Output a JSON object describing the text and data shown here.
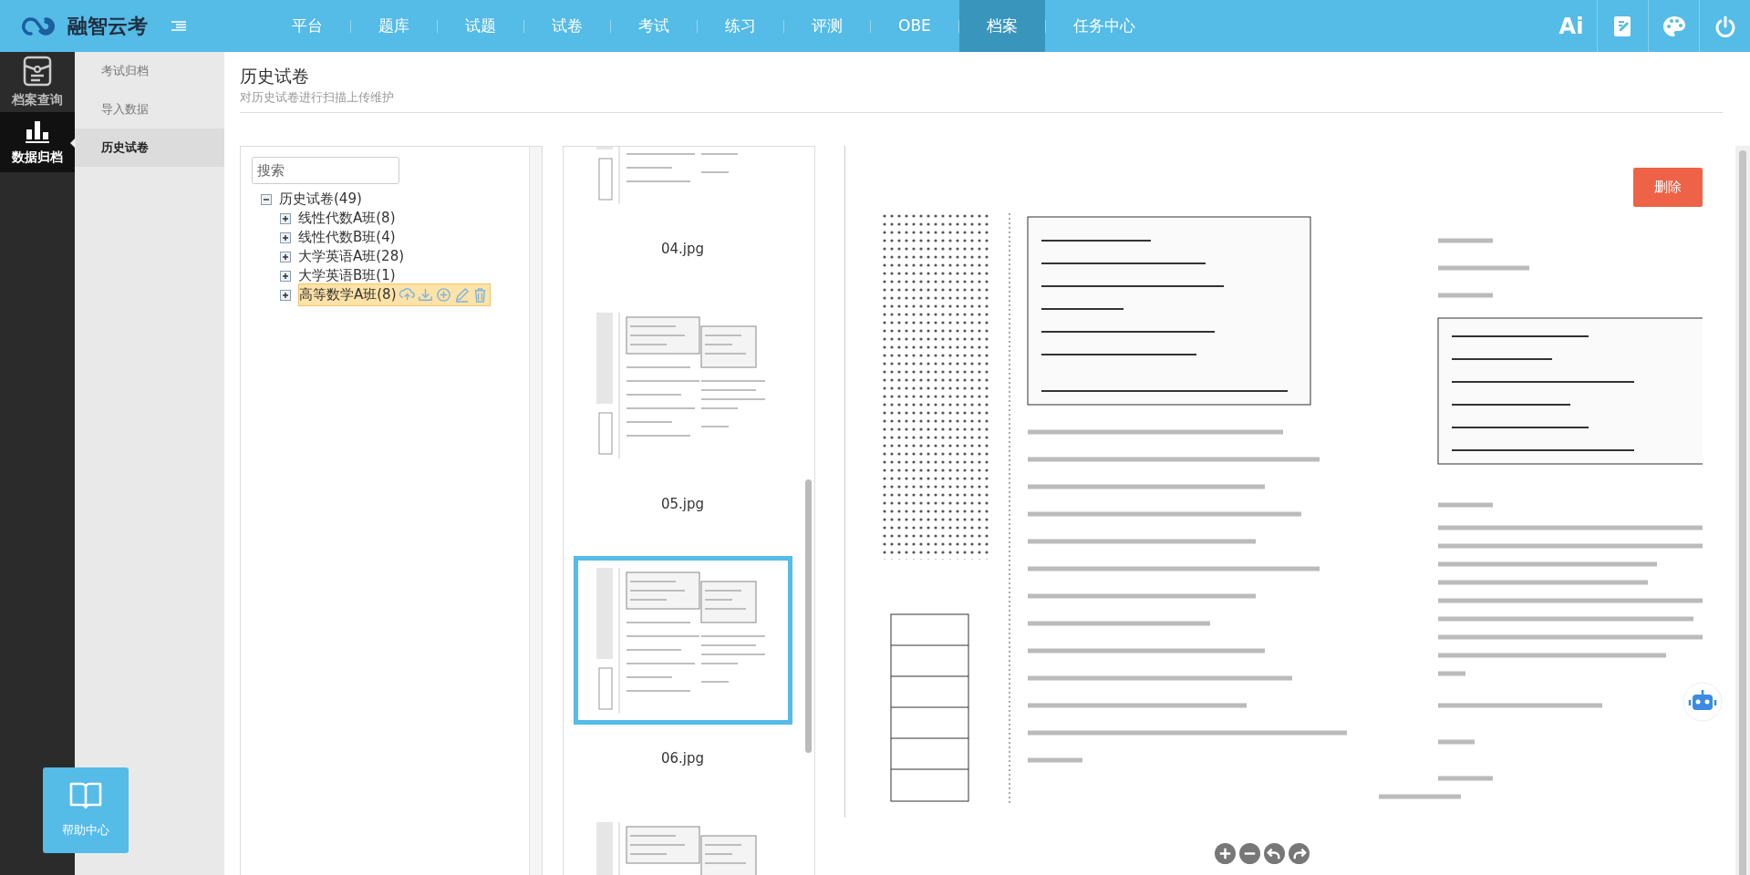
{
  "app": {
    "title": "融智云考"
  },
  "nav": [
    {
      "label": "平台",
      "selected": false
    },
    {
      "label": "题库",
      "selected": false
    },
    {
      "label": "试题",
      "selected": false
    },
    {
      "label": "试卷",
      "selected": false
    },
    {
      "label": "考试",
      "selected": false
    },
    {
      "label": "练习",
      "selected": false
    },
    {
      "label": "评测",
      "selected": false
    },
    {
      "label": "OBE",
      "selected": false
    },
    {
      "label": "档案",
      "selected": true
    },
    {
      "label": "任务中心",
      "selected": false
    }
  ],
  "header_actions": [
    {
      "kind": "ai",
      "label": "Ai"
    },
    {
      "kind": "edit"
    },
    {
      "kind": "palette"
    },
    {
      "kind": "power"
    }
  ],
  "sidebar": {
    "items": [
      {
        "kind": "archive",
        "label": "档案查询",
        "selected": false
      },
      {
        "kind": "chart",
        "label": "数据归档",
        "selected": true
      }
    ],
    "help": "帮助中心"
  },
  "submenu": [
    {
      "label": "考试归档",
      "selected": false
    },
    {
      "label": "导入数据",
      "selected": false
    },
    {
      "label": "历史试卷",
      "selected": true
    }
  ],
  "page": {
    "title": "历史试卷",
    "subtitle": "对历史试卷进行扫描上传维护"
  },
  "tree": {
    "search": {
      "placeholder": "搜索"
    },
    "root": {
      "label": "历史试卷(49)",
      "expanded": true,
      "children": [
        {
          "label": "线性代数A班(8)",
          "expanded": false,
          "selected": false
        },
        {
          "label": "线性代数B班(4)",
          "expanded": false,
          "selected": false
        },
        {
          "label": "大学英语A班(28)",
          "expanded": false,
          "selected": false
        },
        {
          "label": "大学英语B班(1)",
          "expanded": false,
          "selected": false
        },
        {
          "label": "高等数学A班(8)",
          "expanded": false,
          "selected": true
        }
      ]
    }
  },
  "thumbnails": [
    {
      "file": "04.jpg",
      "selected": false
    },
    {
      "file": "05.jpg",
      "selected": false
    },
    {
      "file": "06.jpg",
      "selected": true
    },
    {
      "selected": false
    }
  ],
  "preview": {
    "delete_button": "删除"
  }
}
